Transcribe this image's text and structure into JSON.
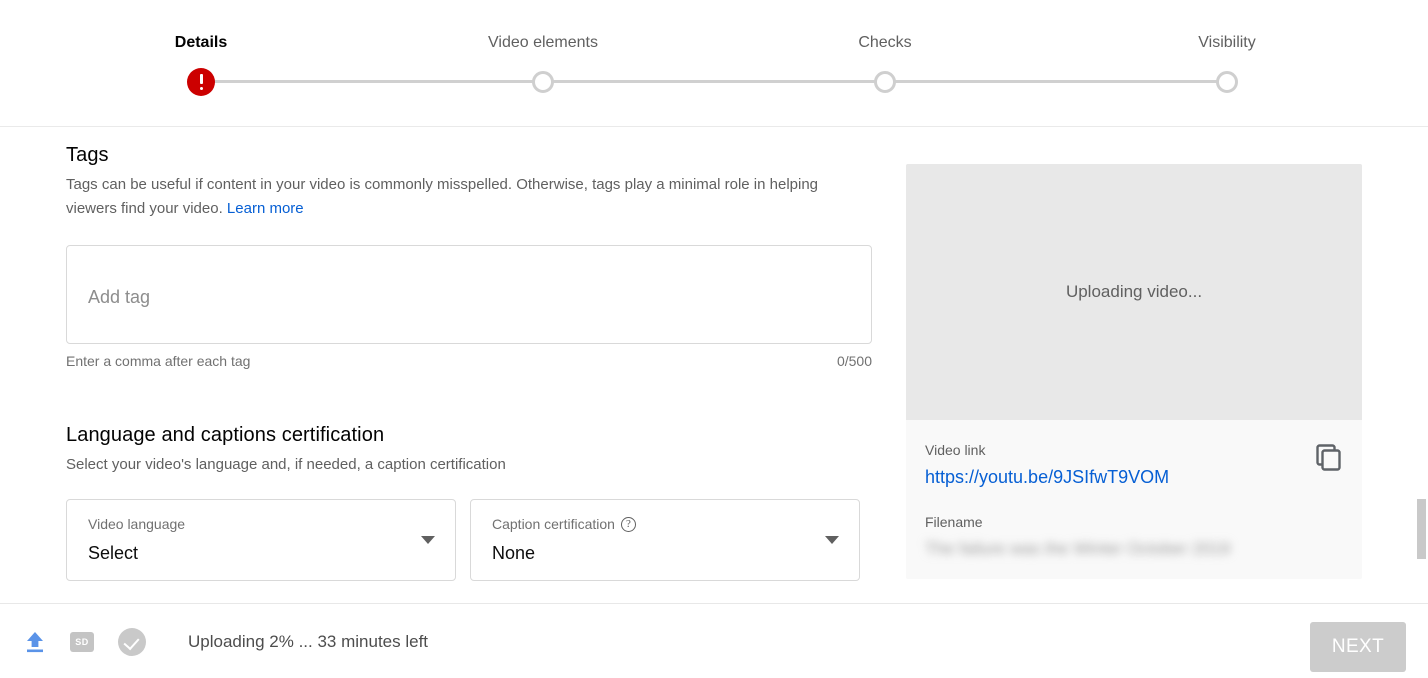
{
  "stepper": {
    "steps": [
      {
        "label": "Details",
        "state": "error",
        "icon": "error-exclamation-icon"
      },
      {
        "label": "Video elements",
        "state": "pending",
        "icon": "circle-outline-icon"
      },
      {
        "label": "Checks",
        "state": "pending",
        "icon": "circle-outline-icon"
      },
      {
        "label": "Visibility",
        "state": "pending",
        "icon": "circle-outline-icon"
      }
    ],
    "error_color": "#cc0000",
    "track_color": "#d0d0d0"
  },
  "tags": {
    "title": "Tags",
    "description": "Tags can be useful if content in your video is commonly misspelled. Otherwise, tags play a minimal role in helping viewers find your video.",
    "learn_more": "Learn more",
    "input_placeholder": "Add tag",
    "input_value": "",
    "helper": "Enter a comma after each tag",
    "counter": "0/500"
  },
  "language": {
    "title": "Language and captions certification",
    "description": "Select your video's language and, if needed, a caption certification",
    "video_language": {
      "label": "Video language",
      "value": "Select"
    },
    "caption_certification": {
      "label": "Caption certification",
      "value": "None",
      "help_glyph": "?"
    }
  },
  "preview": {
    "thumbnail_status": "Uploading video...",
    "video_link_label": "Video link",
    "video_link": "https://youtu.be/9JSIfwT9VOM",
    "copy_icon": "copy-icon",
    "filename_label": "Filename",
    "filename_value": "The failure was the Winter October 2019",
    "filename_redacted": true
  },
  "footer": {
    "icons": [
      {
        "name": "upload-arrow-icon",
        "color": "#5a93e8"
      },
      {
        "name": "sd-quality-badge-icon",
        "label": "SD"
      },
      {
        "name": "checks-complete-icon"
      }
    ],
    "status_text": "Uploading 2% ... 33 minutes left",
    "next_label": "NEXT",
    "next_disabled": true
  },
  "colors": {
    "link": "#065fd4",
    "primary_text": "#030303",
    "secondary_text": "#606060",
    "thumbnail_bg": "#e8e8e8",
    "card_bg": "#f9f9f9",
    "disabled_button": "#cccccc"
  }
}
